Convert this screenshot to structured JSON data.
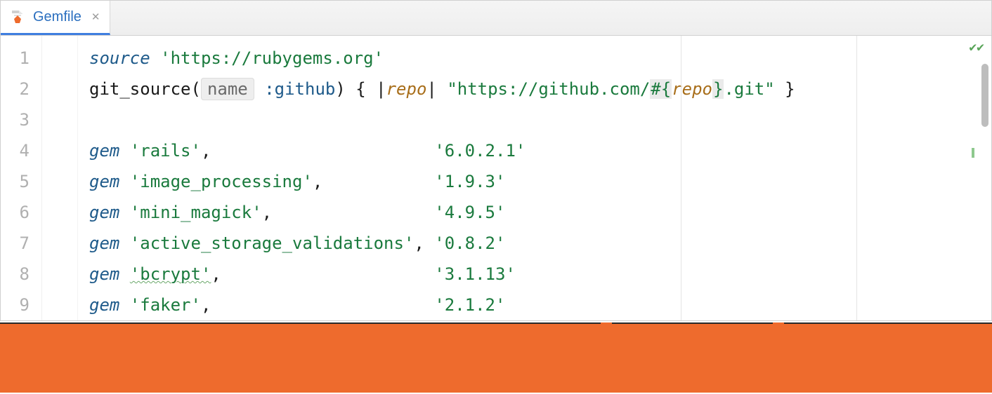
{
  "tab": {
    "label": "Gemfile"
  },
  "gutter": [
    "1",
    "2",
    "3",
    "4",
    "5",
    "6",
    "7",
    "8",
    "9"
  ],
  "code": {
    "l1": {
      "kw": "source",
      "str": "'https://rubygems.org'"
    },
    "l2": {
      "fn": "git_source(",
      "hint": "name",
      "sym": ":github",
      "close": ") { |",
      "param": "repo",
      "mid": "| ",
      "s1": "\"https://github.com/",
      "interp_open": "#{",
      "interp_var": "repo",
      "interp_close": "}",
      "s2": ".git\"",
      "end": " }"
    },
    "gems": [
      {
        "name": "'rails'",
        "pad": ",                      ",
        "ver": "'6.0.2.1'"
      },
      {
        "name": "'image_processing'",
        "pad": ",           ",
        "ver": "'1.9.3'"
      },
      {
        "name": "'mini_magick'",
        "pad": ",                ",
        "ver": "'4.9.5'"
      },
      {
        "name": "'active_storage_validations'",
        "pad": ", ",
        "ver": "'0.8.2'"
      },
      {
        "name": "'bcrypt'",
        "pad": ",                     ",
        "ver": "'3.1.13'",
        "squiggle": true
      },
      {
        "name": "'faker'",
        "pad": ",                      ",
        "ver": "'2.1.2'"
      }
    ],
    "gem_kw": "gem"
  }
}
